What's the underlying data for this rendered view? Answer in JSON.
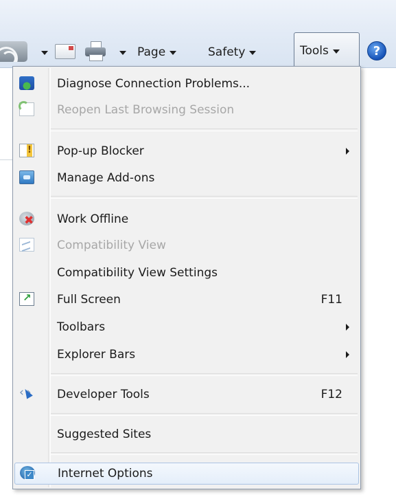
{
  "command_bar": {
    "feeds_icon": "rss-feeds-icon",
    "mail_icon": "read-mail-icon",
    "print_icon": "printer-icon",
    "page_label": "Page",
    "safety_label": "Safety",
    "tools_label": "Tools",
    "help_glyph": "?"
  },
  "tools_menu": {
    "items": [
      {
        "label": "Diagnose Connection Problems...",
        "icon": "diagnose-connection-icon",
        "enabled": true
      },
      {
        "label": "Reopen Last Browsing Session",
        "icon": "reopen-session-icon",
        "enabled": false
      },
      {
        "label": "Pop-up Blocker",
        "icon": "popup-blocker-icon",
        "enabled": true,
        "submenu": true
      },
      {
        "label": "Manage Add-ons",
        "icon": "manage-addons-icon",
        "enabled": true
      },
      {
        "label": "Work Offline",
        "icon": "work-offline-icon",
        "enabled": true
      },
      {
        "label": "Compatibility View",
        "icon": "compatibility-view-icon",
        "enabled": false
      },
      {
        "label": "Compatibility View Settings",
        "icon": "",
        "enabled": true
      },
      {
        "label": "Full Screen",
        "icon": "full-screen-icon",
        "enabled": true,
        "shortcut": "F11"
      },
      {
        "label": "Toolbars",
        "icon": "",
        "enabled": true,
        "submenu": true
      },
      {
        "label": "Explorer Bars",
        "icon": "",
        "enabled": true,
        "submenu": true
      },
      {
        "label": "Developer Tools",
        "icon": "developer-tools-icon",
        "enabled": true,
        "shortcut": "F12"
      },
      {
        "label": "Suggested Sites",
        "icon": "",
        "enabled": true
      },
      {
        "label": "Internet Options",
        "icon": "internet-options-icon",
        "enabled": true,
        "highlighted": true
      }
    ]
  }
}
